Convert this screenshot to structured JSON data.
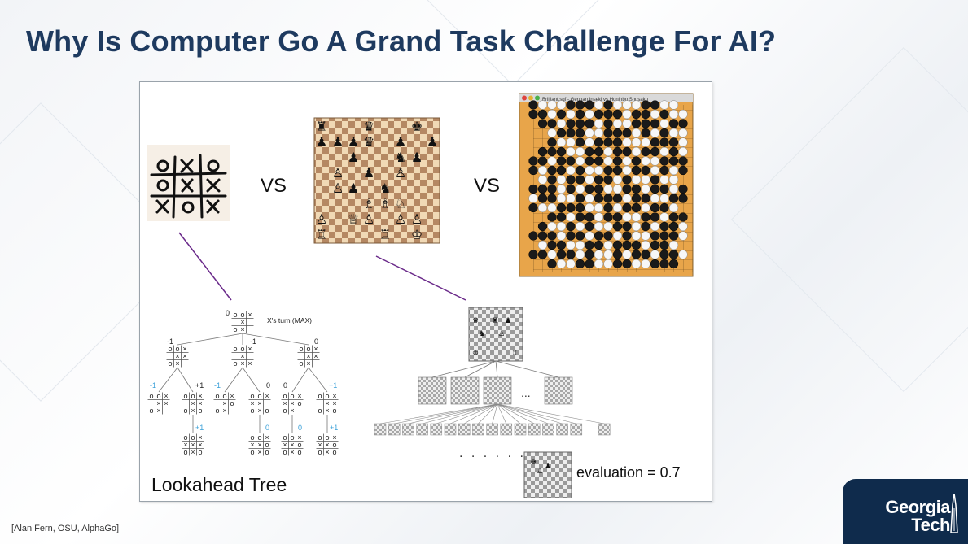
{
  "slide": {
    "title": "Why Is Computer Go A Grand Task Challenge For AI?",
    "citation": "[Alan Fern, OSU, AlphaGo]"
  },
  "comparison": {
    "vs_left": "VS",
    "vs_right": "VS"
  },
  "tictactoe_tree": {
    "label": "Lookahead Tree",
    "root_value": "0",
    "turn_label": "X's turn (MAX)",
    "level1_values": [
      "-1",
      "-1",
      "0"
    ],
    "level2_values": [
      "-1",
      "+1",
      "-1",
      "0",
      "0",
      "+1"
    ],
    "level3_values": [
      "+1",
      "0",
      "0",
      "+1"
    ]
  },
  "chess_tree": {
    "dots": ". . . . . . .",
    "ellipsis": "...",
    "evaluation_label": "evaluation = 0.7"
  },
  "go_window": {
    "title": "Brilliant.sgf - Gennan Inseki vs Honinbo Shusaku"
  },
  "logo": {
    "line1": "Georgia",
    "line2": "Tech"
  },
  "colors": {
    "title": "#1e3a5f",
    "tree_line": "#6a2a8a",
    "value_blue": "#3aa0d8",
    "go_board": "#e8a54a",
    "logo_bg": "#0f2b4c"
  }
}
